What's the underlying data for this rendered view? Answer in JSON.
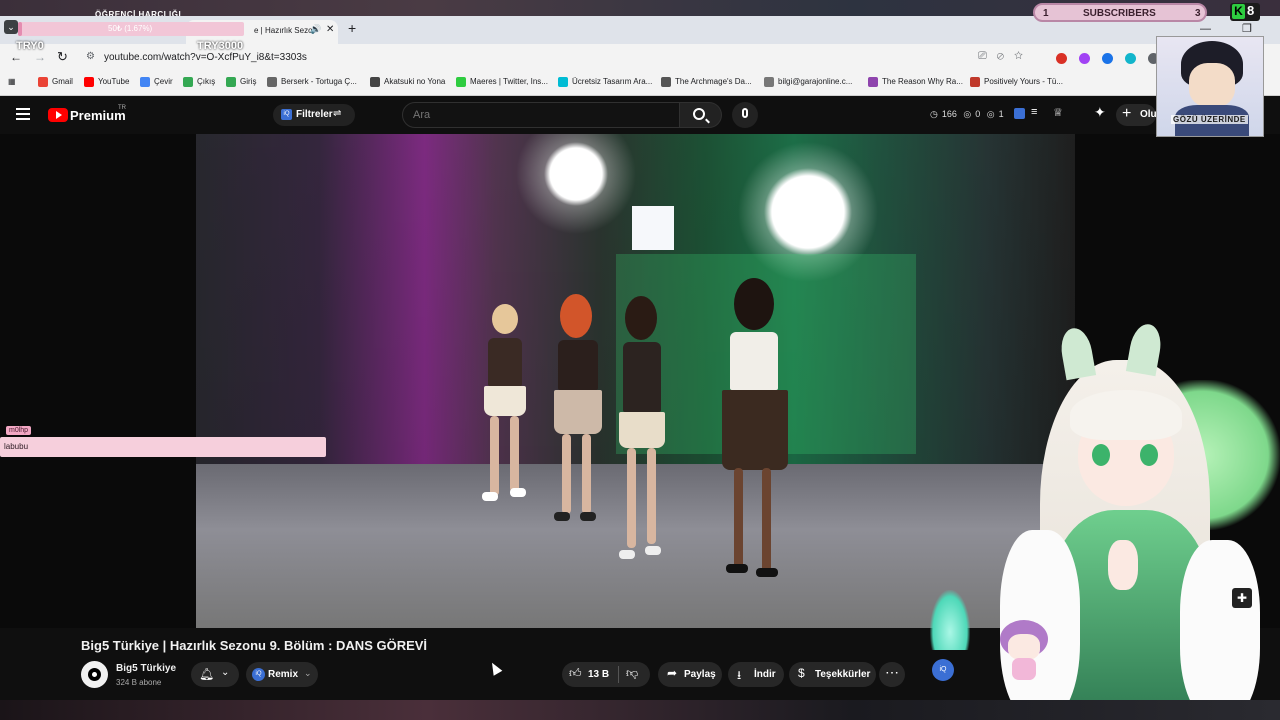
{
  "stream_overlay": {
    "goal_label": "ÖĞRENCİ HARÇLIĞI",
    "goal_progress_text": "50₺ (1.67%)",
    "goal_progress_fraction": 0.0167,
    "try_left": "TRY0",
    "try_right": "TRY3000",
    "subs_left_num": "1",
    "subs_label": "SUBSCRIBERS",
    "subs_right_num": "3",
    "k_badge_count": "8",
    "webcam_caption": "GÖZÜ ÜZERİNDE",
    "chat": {
      "username": "m0lhp",
      "message": "labubu"
    }
  },
  "browser": {
    "tab_title": "e | Hazırlık Sezo",
    "new_tab_symbol": "+",
    "window_controls": "—  ❐  ✕",
    "url": "youtube.com/watch?v=O-XcfPuY_i8&t=3303s",
    "bookmarks": [
      {
        "label": "Gmail",
        "color": "#ea4335"
      },
      {
        "label": "YouTube",
        "color": "#ff0000"
      },
      {
        "label": "Çevir",
        "color": "#4285f4"
      },
      {
        "label": "Çıkış",
        "color": "#34a853"
      },
      {
        "label": "Giriş",
        "color": "#34a853"
      },
      {
        "label": "Berserk - Tortuga Ç...",
        "color": "#666666"
      },
      {
        "label": "Akatsuki no Yona",
        "color": "#444444"
      },
      {
        "label": "Maeres | Twitter, Ins...",
        "color": "#2ecc40"
      },
      {
        "label": "Ücretsiz Tasarım Ara...",
        "color": "#00bcd4"
      },
      {
        "label": "The Archmage's Da...",
        "color": "#555555"
      },
      {
        "label": "bilgi@garajonline.c...",
        "color": "#777777"
      },
      {
        "label": "The Reason Why Ra...",
        "color": "#8e44ad"
      },
      {
        "label": "Positively Yours - Tü...",
        "color": "#c0392b"
      }
    ]
  },
  "youtube": {
    "brand": "Premium",
    "region": "TR",
    "filters_label": "Filtreler",
    "search_placeholder": "Ara",
    "stats": {
      "views": "166",
      "a": "0",
      "b": "1"
    },
    "create_label": "Olu",
    "video": {
      "title": "Big5 Türkiye | Hazırlık Sezonu 9. Bölüm : DANS GÖREVİ",
      "channel": "Big5 Türkiye",
      "subscribers": "324 B abone",
      "remix_label": "Remix",
      "likes": "13 B",
      "share_label": "Paylaş",
      "download_label": "İndir",
      "thanks_label": "Teşekkürler"
    }
  },
  "colors": {
    "yt_red": "#ff0000",
    "iq_blue": "#3b6fd4",
    "overlay_pink": "#f6cfdc"
  }
}
